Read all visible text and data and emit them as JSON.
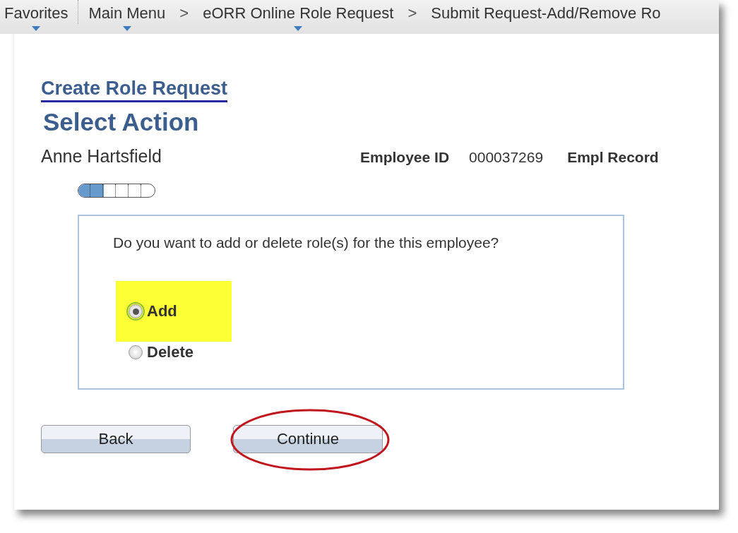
{
  "breadcrumb": [
    {
      "kind": "link",
      "label": "Favorites",
      "menu": true
    },
    {
      "kind": "rule"
    },
    {
      "kind": "link",
      "label": "Main Menu",
      "menu": true
    },
    {
      "kind": "separator",
      "label": ">"
    },
    {
      "kind": "link",
      "label": "eORR Online Role Request",
      "menu": true
    },
    {
      "kind": "separator",
      "label": ">"
    },
    {
      "kind": "link",
      "label": "Submit Request-Add/Remove Ro",
      "menu": false
    }
  ],
  "link": "Create Role Request",
  "title": "Select Action",
  "employee": {
    "name": "Anne Hartsfield",
    "id_label": "Employee ID",
    "id_value": "000037269",
    "record_label": "Empl Record"
  },
  "progress": {
    "level": 0.33
  },
  "question": "Do you want to add or delete role(s) for the this employee?",
  "options": [
    {
      "label": "Add",
      "selected": true,
      "highlighted": true
    },
    {
      "label": "Delete",
      "selected": false,
      "highlighted": false
    }
  ],
  "buttons": [
    {
      "label": "Back",
      "circled": false
    },
    {
      "label": "Continue",
      "circled": true
    }
  ]
}
